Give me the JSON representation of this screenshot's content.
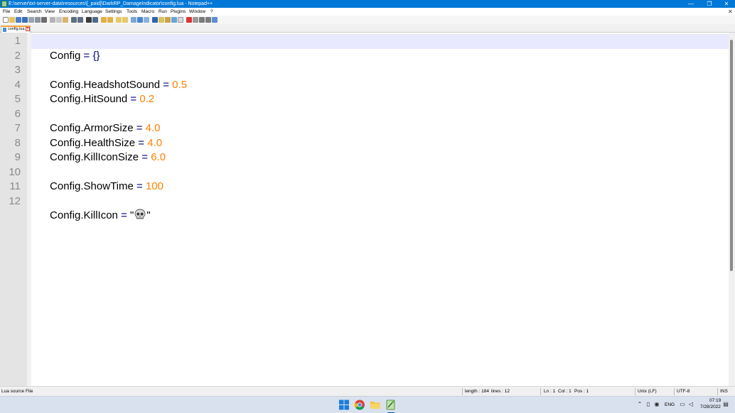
{
  "window": {
    "title": "E:\\server\\txt-server-data\\resources\\[_paid]\\DarkRP_DamageIndicator\\config.lua - Notepad++",
    "minimize_glyph": "—",
    "maximize_glyph": "❐",
    "close_glyph": "✕"
  },
  "menu": {
    "items": [
      "File",
      "Edit",
      "Search",
      "View",
      "Encoding",
      "Language",
      "Settings",
      "Tools",
      "Macro",
      "Run",
      "Plugins",
      "Window",
      "?"
    ],
    "close_glyph": "✕"
  },
  "toolbar": {
    "buttons": [
      "new-file",
      "open",
      "save",
      "save-all",
      "close",
      "close-all",
      "print",
      "cut",
      "copy",
      "paste",
      "undo",
      "redo",
      "find",
      "replace",
      "zoom-in",
      "zoom-out",
      "sync-vertical",
      "sync-horizontal",
      "word-wrap",
      "show-all-chars",
      "indent-guide",
      "user-language",
      "doc-map",
      "function-list",
      "folder-workspace",
      "monitoring",
      "record-macro",
      "stop-macro",
      "play-macro",
      "run-macro-multiple",
      "save-macro"
    ]
  },
  "tab": {
    "label": "config.lua",
    "close_glyph": "x"
  },
  "editor": {
    "current_line": 1,
    "lines": [
      {
        "number": "1",
        "segments": [
          {
            "text": "Config ",
            "kind": "ident"
          },
          {
            "text": "= {}",
            "kind": "op"
          }
        ]
      },
      {
        "number": "2",
        "segments": []
      },
      {
        "number": "3",
        "segments": [
          {
            "text": "Config.HeadshotSound ",
            "kind": "ident"
          },
          {
            "text": "= ",
            "kind": "op"
          },
          {
            "text": "0.5",
            "kind": "num"
          }
        ]
      },
      {
        "number": "4",
        "segments": [
          {
            "text": "Config.HitSound ",
            "kind": "ident"
          },
          {
            "text": "= ",
            "kind": "op"
          },
          {
            "text": "0.2",
            "kind": "num"
          }
        ]
      },
      {
        "number": "5",
        "segments": []
      },
      {
        "number": "6",
        "segments": [
          {
            "text": "Config.ArmorSize ",
            "kind": "ident"
          },
          {
            "text": "= ",
            "kind": "op"
          },
          {
            "text": "4.0",
            "kind": "num"
          }
        ]
      },
      {
        "number": "7",
        "segments": [
          {
            "text": "Config.HealthSize ",
            "kind": "ident"
          },
          {
            "text": "= ",
            "kind": "op"
          },
          {
            "text": "4.0",
            "kind": "num"
          }
        ]
      },
      {
        "number": "8",
        "segments": [
          {
            "text": "Config.KillIconSize ",
            "kind": "ident"
          },
          {
            "text": "= ",
            "kind": "op"
          },
          {
            "text": "6.0",
            "kind": "num"
          }
        ]
      },
      {
        "number": "9",
        "segments": []
      },
      {
        "number": "10",
        "segments": [
          {
            "text": "Config.ShowTime ",
            "kind": "ident"
          },
          {
            "text": "= ",
            "kind": "op"
          },
          {
            "text": "100",
            "kind": "num"
          }
        ]
      },
      {
        "number": "11",
        "segments": []
      },
      {
        "number": "12",
        "segments": [
          {
            "text": "Config.KillIcon ",
            "kind": "ident"
          },
          {
            "text": "= ",
            "kind": "op"
          },
          {
            "text": "\"",
            "kind": "str"
          },
          {
            "icon": "skull-icon",
            "kind": "emoji"
          },
          {
            "text": "\"",
            "kind": "str"
          }
        ]
      }
    ]
  },
  "status": {
    "file_type": "Lua source File",
    "length": "length : 184",
    "lines": "lines : 12",
    "ln": "Ln : 1",
    "col": "Col : 1",
    "pos": "Pos : 1",
    "eol": "Unix (LF)",
    "encoding": "UTF-8",
    "mode": "INS"
  },
  "taskbar": {
    "apps": [
      "windows-start-icon",
      "chrome-icon",
      "file-explorer-icon",
      "notepad-plus-plus-icon"
    ],
    "tray": {
      "language": "ENG",
      "time": "07:19",
      "date": "7/28/2022"
    }
  },
  "colors": {
    "titlebar": "#0078d7",
    "number": "#ff8000",
    "operator": "#000080",
    "current_line": "#e8e8ff",
    "gutter": "#e4e4e4",
    "tab_accent": "#f7a33a"
  }
}
